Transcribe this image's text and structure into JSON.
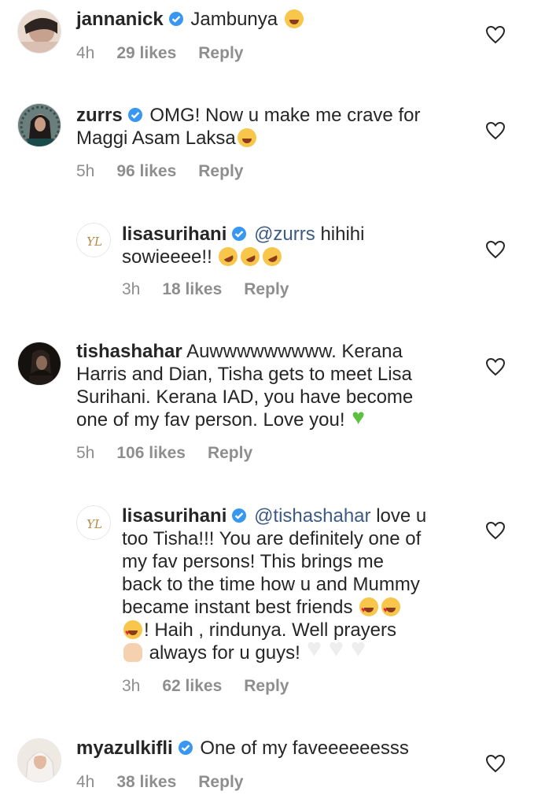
{
  "comments": [
    {
      "username": "jannanick",
      "verified": true,
      "text": "Jambunya",
      "emoji_after": "laughing-tears",
      "time": "4h",
      "likes": "29 likes",
      "reply": "Reply"
    },
    {
      "username": "zurrs",
      "verified": true,
      "text_line1": "OMG! Now u make me crave for",
      "text_line2": "Maggi Asam Laksa",
      "emoji_after": "yum",
      "time": "5h",
      "likes": "96 likes",
      "reply": "Reply"
    },
    {
      "username": "lisasurihani",
      "verified": true,
      "mention": "@zurrs",
      "text_line1": "hihihi",
      "text_line2": "sowieeee!!",
      "emoji_after": "rofl x3",
      "time": "3h",
      "likes": "18 likes",
      "reply": "Reply"
    },
    {
      "username": "tishashahar",
      "verified": false,
      "text_line1": "Auwwwwwwwww. Kerana",
      "text_line2": "Harris and Dian, Tisha gets to meet Lisa",
      "text_line3": "Surihani. Kerana IAD, you have become",
      "text_line4": "one of my fav person. Love you!",
      "emoji_after": "green-heart",
      "time": "5h",
      "likes": "106 likes",
      "reply": "Reply"
    },
    {
      "username": "lisasurihani",
      "verified": true,
      "mention": "@tishashahar",
      "text_line1": "love u",
      "text_line2": "too Tisha!!! You are definitely one of",
      "text_line3": "my fav persons! This brings me",
      "text_line4": "back to the time how u and Mummy",
      "text_line5": "became instant best friends",
      "text_line6": "! Haih , rindunya. Well prayers",
      "text_line7": "always for u guys!",
      "emoji_after": "heart-eyes x3, raised-hands, white-heart x3",
      "time": "3h",
      "likes": "62 likes",
      "reply": "Reply"
    },
    {
      "username": "myazulkifli",
      "verified": true,
      "text": "One of my faveeeeeesss",
      "time": "4h",
      "likes": "38 likes",
      "reply": "Reply"
    }
  ],
  "colors": {
    "text": "#262626",
    "meta": "#8e8e8e",
    "verified": "#3897f0",
    "mention": "#3b5a86"
  },
  "icons": {
    "verified": "verified-badge-icon",
    "like": "heart-outline-icon"
  }
}
